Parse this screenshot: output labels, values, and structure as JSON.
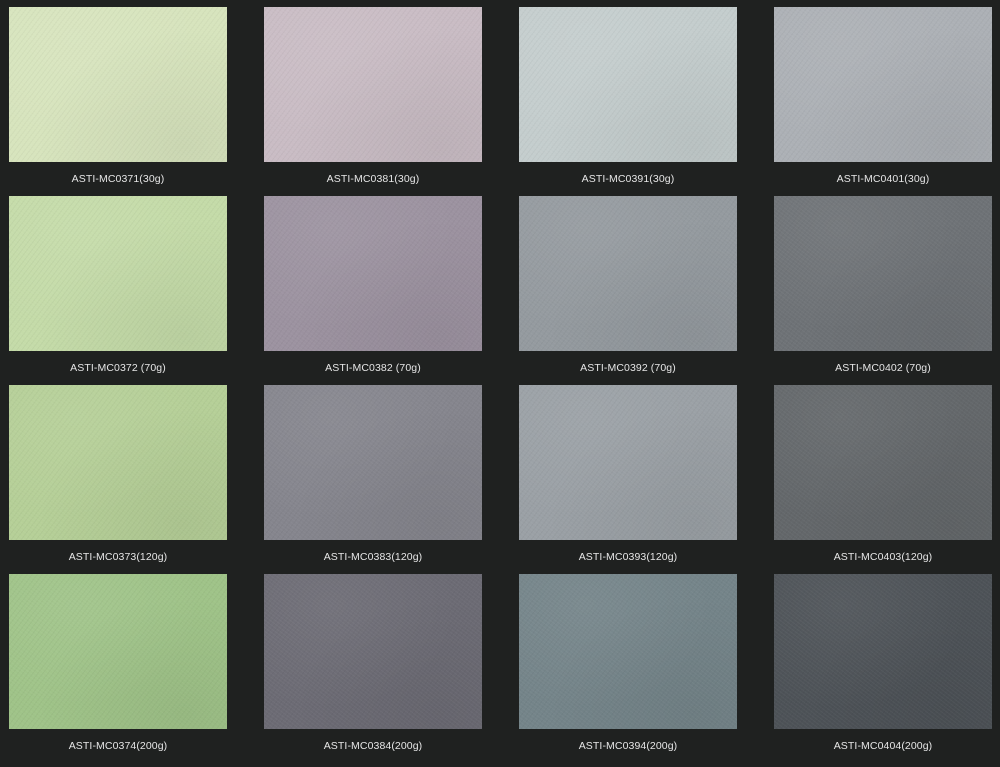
{
  "swatches": [
    {
      "label": "ASTI-MC0371(30g)",
      "color": "#d7e4bd"
    },
    {
      "label": "ASTI-MC0381(30g)",
      "color": "#c9bcc4"
    },
    {
      "label": "ASTI-MC0391(30g)",
      "color": "#c4cdcd"
    },
    {
      "label": "ASTI-MC0401(30g)",
      "color": "#acb0b5"
    },
    {
      "label": "ASTI-MC0372 (70g)",
      "color": "#c4dba8"
    },
    {
      "label": "ASTI-MC0382 (70g)",
      "color": "#9c92a0"
    },
    {
      "label": "ASTI-MC0392 (70g)",
      "color": "#949a9f"
    },
    {
      "label": "ASTI-MC0402 (70g)",
      "color": "#6e7276"
    },
    {
      "label": "ASTI-MC0373(120g)",
      "color": "#b5cf97"
    },
    {
      "label": "ASTI-MC0383(120g)",
      "color": "#85858d"
    },
    {
      "label": "ASTI-MC0393(120g)",
      "color": "#9aa0a5"
    },
    {
      "label": "ASTI-MC0403(120g)",
      "color": "#63676a"
    },
    {
      "label": "ASTI-MC0374(200g)",
      "color": "#9fc388"
    },
    {
      "label": "ASTI-MC0384(200g)",
      "color": "#6c6b74"
    },
    {
      "label": "ASTI-MC0394(200g)",
      "color": "#748489"
    },
    {
      "label": "ASTI-MC0404(200g)",
      "color": "#4d5257"
    }
  ],
  "background": "#1f2120"
}
